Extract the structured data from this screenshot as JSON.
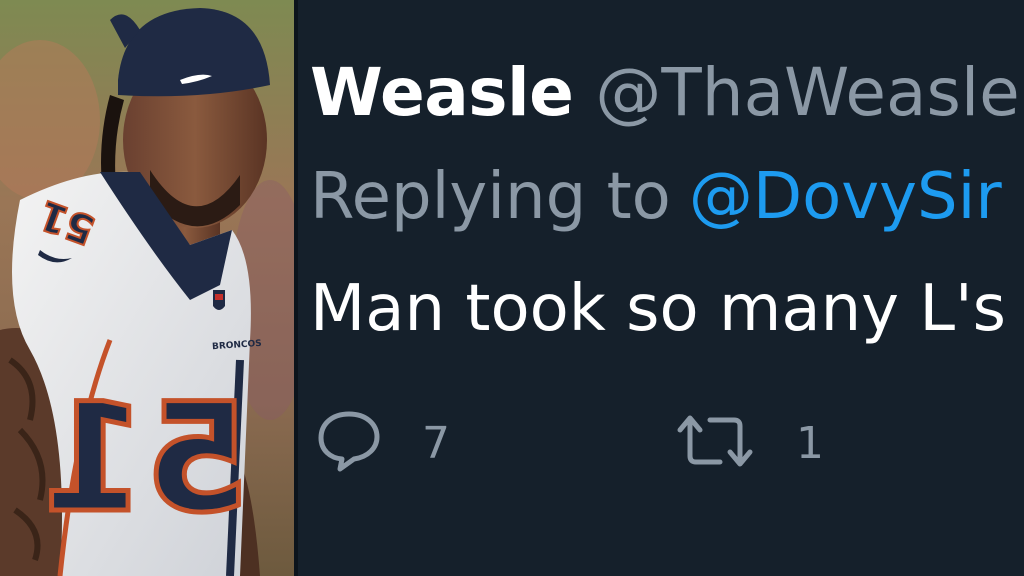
{
  "tweet": {
    "display_name": "Weasle",
    "handle": "@ThaWeasle",
    "reply_prefix": "Replying to",
    "reply_handle": "@DovySir",
    "text": "Man took so many L's",
    "reply_count": "7",
    "retweet_count": "1",
    "icons": {
      "reply": "speech-bubble-icon",
      "retweet": "retweet-arrows-icon"
    }
  },
  "photo": {
    "jersey_number": "51",
    "jersey_wordmark": "BRONCOS"
  },
  "colors": {
    "background": "#15202b",
    "name": "#ffffff",
    "muted": "#8b98a5",
    "link": "#1d9bf0"
  }
}
